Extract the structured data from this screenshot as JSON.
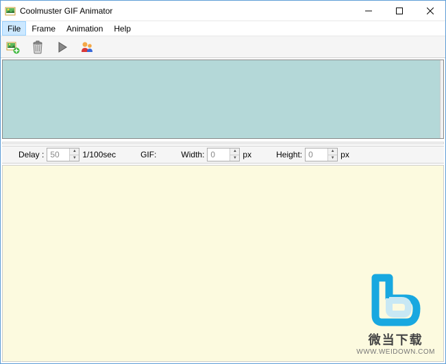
{
  "window": {
    "title": "Coolmuster GIF Animator"
  },
  "menubar": {
    "file": "File",
    "frame": "Frame",
    "animation": "Animation",
    "help": "Help"
  },
  "settings": {
    "delay_label": "Delay :",
    "delay_value": "50",
    "delay_unit": "1/100sec",
    "gif_label": "GIF:",
    "width_label": "Width:",
    "width_value": "0",
    "width_unit": "px",
    "height_label": "Height:",
    "height_value": "0",
    "height_unit": "px"
  },
  "watermark": {
    "text1": "微当下载",
    "text2": "WWW.WEIDOWN.COM"
  }
}
